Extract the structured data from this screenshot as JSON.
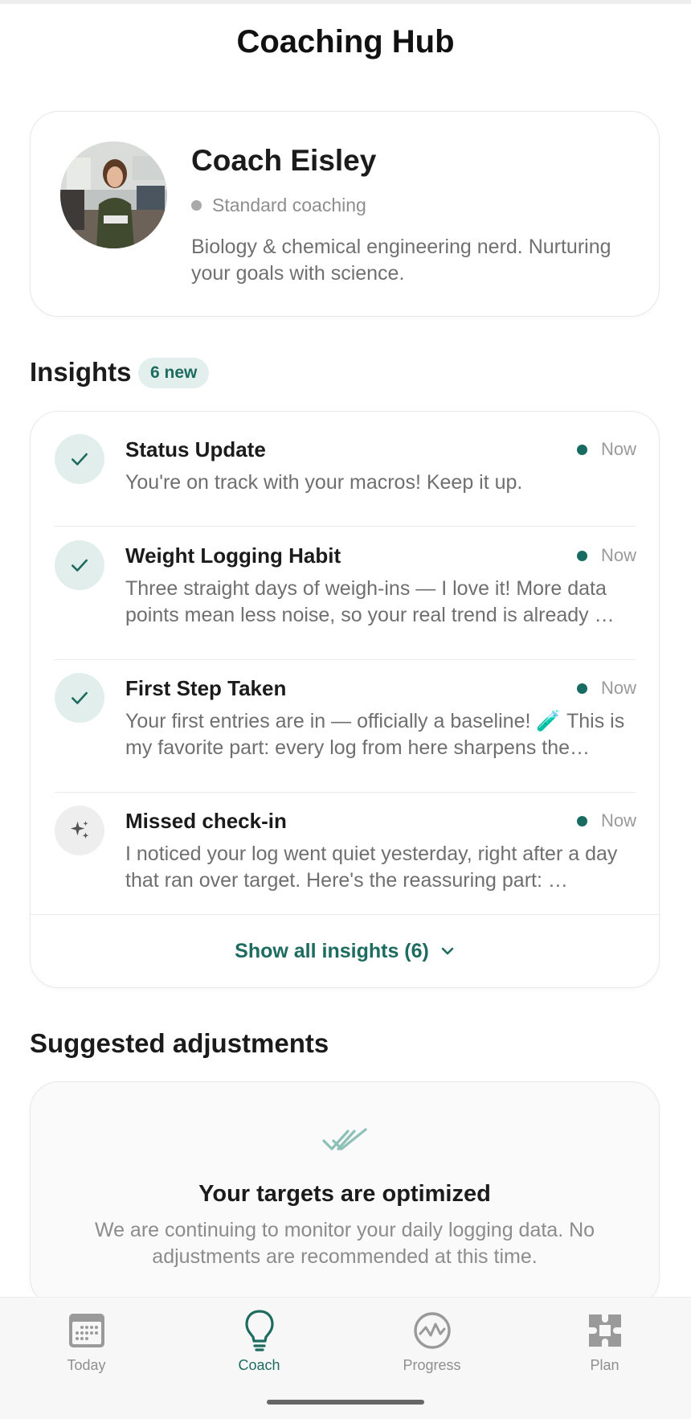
{
  "header": {
    "title": "Coaching Hub"
  },
  "coach": {
    "name": "Coach Eisley",
    "status": "Standard coaching",
    "bio": "Biology & chemical engineering nerd. Nurturing your goals with science."
  },
  "insights": {
    "heading": "Insights",
    "badge": "6 new",
    "items": [
      {
        "title": "Status Update",
        "time": "Now",
        "icon": "check-icon",
        "body": "You're on track with your macros! Keep it up."
      },
      {
        "title": "Weight Logging Habit",
        "time": "Now",
        "icon": "check-icon",
        "body": "Three straight days of weigh-ins — I love it! More data points mean less noise, so your real trend is already …"
      },
      {
        "title": "First Step Taken",
        "time": "Now",
        "icon": "check-icon",
        "body": "Your first entries are in — officially a baseline! 🧪 This is my favorite part: every log from here sharpens the…"
      },
      {
        "title": "Missed check-in",
        "time": "Now",
        "icon": "sparkle-icon",
        "body": "I noticed your log went quiet yesterday, right after a day that ran over target. Here's the reassuring part: …"
      }
    ],
    "show_all": "Show all insights (6)"
  },
  "adjustments": {
    "heading": "Suggested adjustments",
    "title": "Your targets are optimized",
    "text": "We are continuing to monitor your daily logging data. No adjustments are recommended at this time."
  },
  "nav": {
    "items": [
      {
        "label": "Today",
        "icon": "calendar-icon"
      },
      {
        "label": "Coach",
        "icon": "lightbulb-icon",
        "active": true
      },
      {
        "label": "Progress",
        "icon": "progress-chart-icon"
      },
      {
        "label": "Plan",
        "icon": "plan-puzzle-icon"
      }
    ]
  },
  "colors": {
    "accent": "#1e6b60",
    "accent_light": "#e1eeec",
    "muted": "#8f8f8f"
  }
}
